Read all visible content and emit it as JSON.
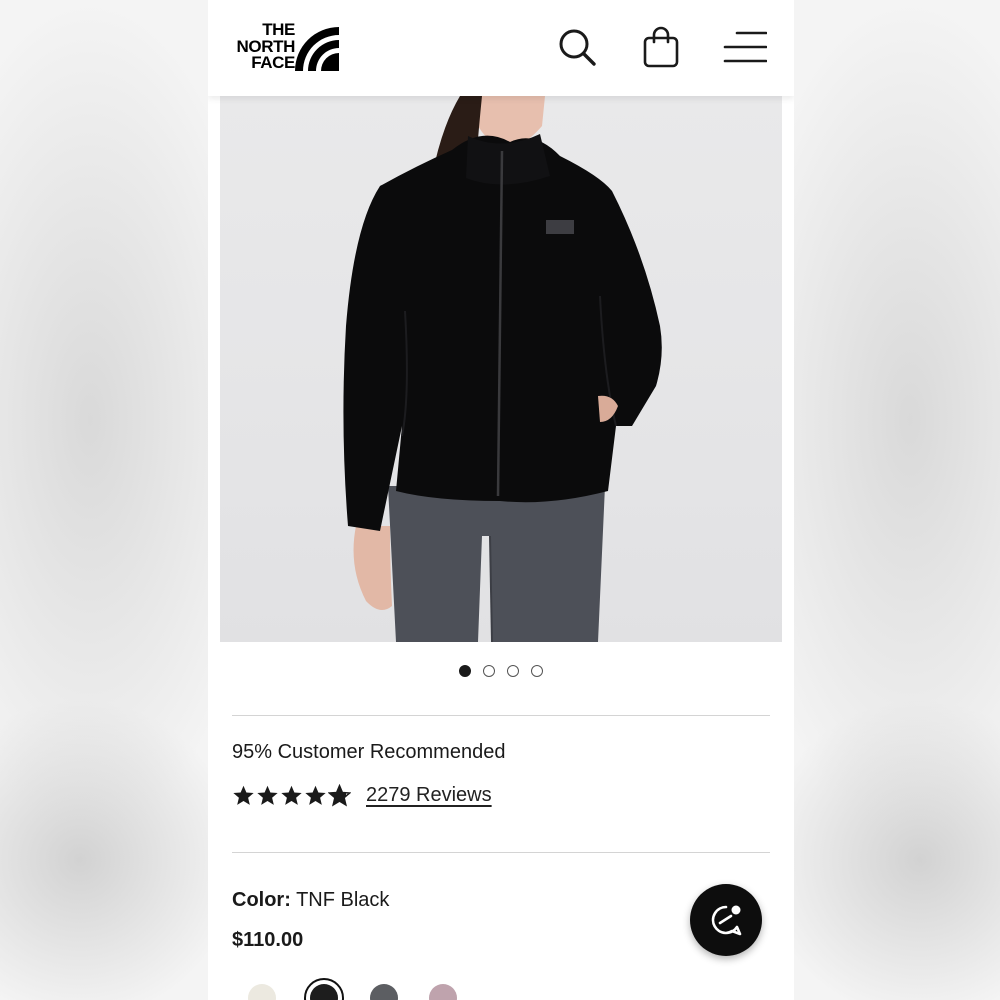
{
  "header": {
    "logo_lines": [
      "THE",
      "NORTH",
      "FACE"
    ],
    "icons": [
      "search-icon",
      "shopping-bag-icon",
      "hamburger-menu-icon"
    ]
  },
  "product": {
    "image": "model wearing black fleece jacket with grey pants",
    "gallery": {
      "count": 4,
      "active_index": 0
    }
  },
  "reviews": {
    "recommended_text": "95% Customer Recommended",
    "stars": 5,
    "review_count_text": "2279 Reviews"
  },
  "selection": {
    "color_label": "Color:",
    "color_value": "TNF Black",
    "price": "$110.00",
    "swatches": [
      {
        "color": "#ece9e0",
        "selected": false
      },
      {
        "color": "#1d1d1d",
        "selected": true
      },
      {
        "color": "#5c5e62",
        "selected": false
      },
      {
        "color": "#bfa3ad",
        "selected": false
      }
    ]
  },
  "colors": {
    "brand": "#000000",
    "text": "#1a1a1a",
    "divider": "#d4d4d4",
    "chat_button": "#0d0d0d"
  },
  "chat": {
    "icon": "chat-bubble-icon"
  }
}
